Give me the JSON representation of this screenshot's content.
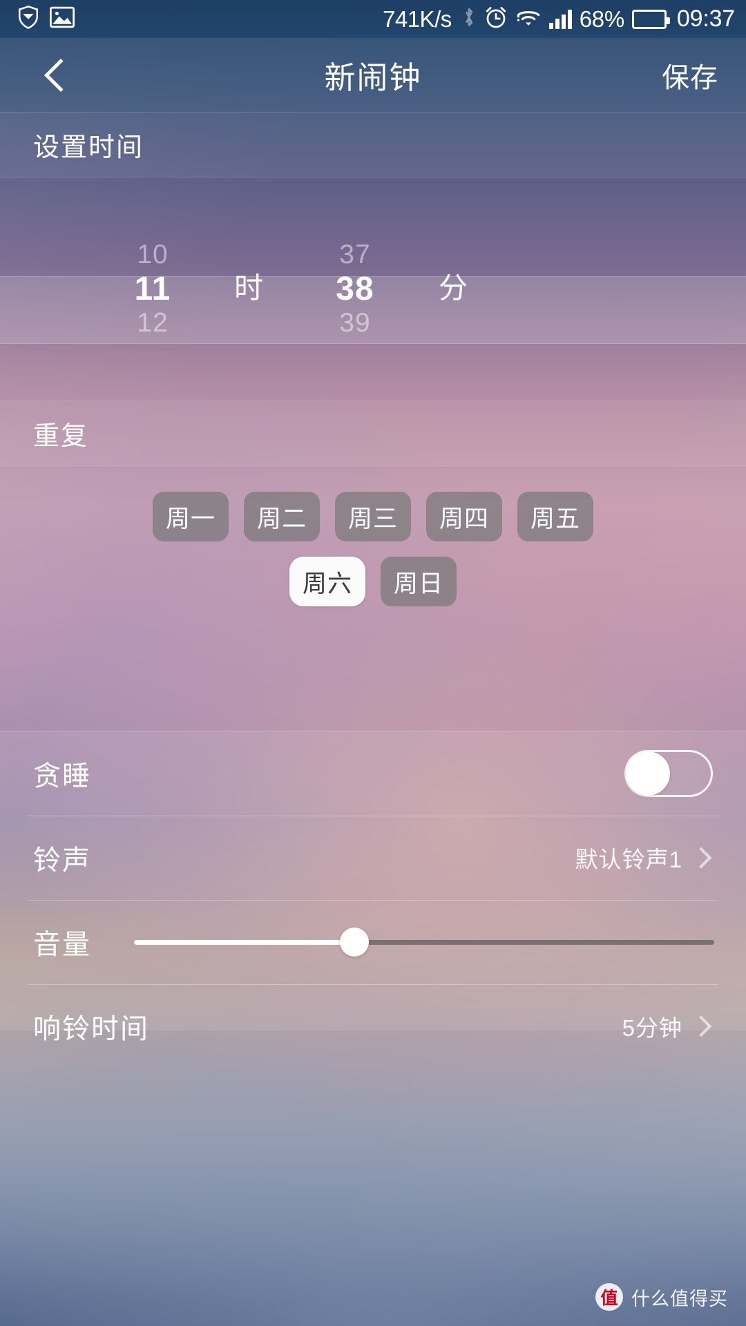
{
  "statusbar": {
    "download_icon": "shield-download-icon",
    "screenshot_icon": "image-icon",
    "net_speed": "741K/s",
    "bluetooth_icon": "bluetooth-icon",
    "alarm_icon": "alarm-clock-icon",
    "wifi_icon": "wifi-icon",
    "signal_icon": "signal-bars-icon",
    "battery_percent": "68%",
    "battery_level": 68,
    "battery_icon": "battery-icon",
    "clock": "09:37"
  },
  "titlebar": {
    "back_icon": "chevron-left-icon",
    "title": "新闹钟",
    "save_label": "保存"
  },
  "time_section": {
    "header": "设置时间",
    "hours": {
      "prev": "10",
      "selected": "11",
      "next": "12",
      "unit": "时"
    },
    "minutes": {
      "prev": "37",
      "selected": "38",
      "next": "39",
      "unit": "分"
    }
  },
  "repeat_section": {
    "header": "重复",
    "days": [
      {
        "label": "周一",
        "selected": false
      },
      {
        "label": "周二",
        "selected": false
      },
      {
        "label": "周三",
        "selected": false
      },
      {
        "label": "周四",
        "selected": false
      },
      {
        "label": "周五",
        "selected": false
      },
      {
        "label": "周六",
        "selected": true
      },
      {
        "label": "周日",
        "selected": false
      }
    ]
  },
  "settings": {
    "snooze": {
      "label": "贪睡",
      "toggle_on": false
    },
    "ringtone": {
      "label": "铃声",
      "value": "默认铃声1",
      "chevron": "chevron-right-icon"
    },
    "volume": {
      "label": "音量",
      "percent": 38
    },
    "ring_duration": {
      "label": "响铃时间",
      "value": "5分钟",
      "chevron": "chevron-right-icon"
    }
  },
  "watermark": {
    "badge": "值",
    "text": "什么值得买"
  },
  "colors": {
    "statusbar_bg": "#22456c",
    "titlebar_bg": "#4e6486",
    "chip_bg": "#787878",
    "chip_selected_bg": "#fbfbfb",
    "accent_white": "#ffffff"
  }
}
